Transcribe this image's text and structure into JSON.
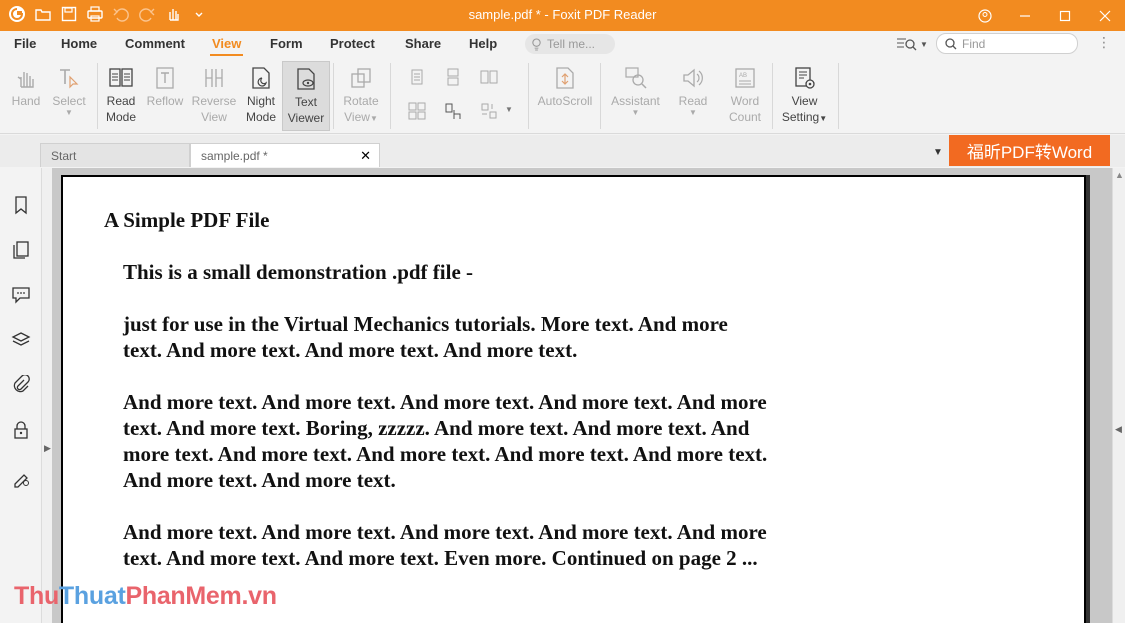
{
  "window": {
    "title": "sample.pdf * - Foxit PDF Reader"
  },
  "menu": {
    "tabs": [
      "File",
      "Home",
      "Comment",
      "View",
      "Form",
      "Protect",
      "Share",
      "Help"
    ],
    "active_tab": "View",
    "tell_me_placeholder": "Tell me...",
    "find_placeholder": "Find"
  },
  "ribbon": {
    "hand": [
      "Hand",
      ""
    ],
    "select": [
      "Select",
      ""
    ],
    "read_mode": [
      "Read",
      "Mode"
    ],
    "reflow": [
      "Reflow",
      ""
    ],
    "reverse_view": [
      "Reverse",
      "View"
    ],
    "night_mode": [
      "Night",
      "Mode"
    ],
    "text_viewer": [
      "Text",
      "Viewer"
    ],
    "rotate_view": [
      "Rotate",
      "View"
    ],
    "autoscroll": [
      "AutoScroll",
      ""
    ],
    "assistant": [
      "Assistant",
      ""
    ],
    "read": [
      "Read",
      ""
    ],
    "word_count": [
      "Word",
      "Count"
    ],
    "view_setting": [
      "View",
      "Setting"
    ]
  },
  "tabs": {
    "start": "Start",
    "doc": "sample.pdf *",
    "close": "✕"
  },
  "convert_button": "福昕PDF转Word",
  "document": {
    "heading": "A Simple PDF File",
    "paragraphs": [
      [
        "This is a small demonstration .pdf file -"
      ],
      [
        "just for use in the Virtual Mechanics tutorials. More text. And more",
        "text. And more text. And more text. And more text."
      ],
      [
        "And more text. And more text. And more text. And more text. And more",
        "text. And more text. Boring, zzzzz. And more text. And more text. And",
        "more text. And more text. And more text. And more text. And more text.",
        "And more text. And more text."
      ],
      [
        "And more text. And more text. And more text. And more text. And more",
        "text. And more text. And more text. Even more. Continued on page 2 ..."
      ]
    ]
  },
  "watermark": {
    "part1": "Thu",
    "part2": "Thuat",
    "part3": "PhanMem.vn"
  },
  "colors": {
    "brand_orange": "#f28b20",
    "convert_orange": "#f26a21"
  }
}
